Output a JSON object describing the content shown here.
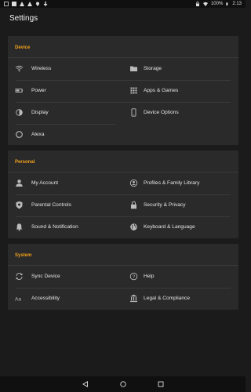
{
  "status_bar": {
    "time": "2:13",
    "battery": "100%"
  },
  "app_bar": {
    "title": "Settings"
  },
  "sections": [
    {
      "title": "Device",
      "items": [
        {
          "label": "Wireless",
          "icon": "wifi-icon"
        },
        {
          "label": "Storage",
          "icon": "folder-icon"
        },
        {
          "label": "Power",
          "icon": "battery-icon"
        },
        {
          "label": "Apps & Games",
          "icon": "apps-grid-icon"
        },
        {
          "label": "Display",
          "icon": "brightness-icon"
        },
        {
          "label": "Device Options",
          "icon": "phone-icon"
        },
        {
          "label": "Alexa",
          "icon": "alexa-ring-icon"
        }
      ]
    },
    {
      "title": "Personal",
      "items": [
        {
          "label": "My Account",
          "icon": "person-icon"
        },
        {
          "label": "Profiles & Family Library",
          "icon": "profiles-icon"
        },
        {
          "label": "Parental Controls",
          "icon": "shield-icon"
        },
        {
          "label": "Security & Privacy",
          "icon": "lock-icon"
        },
        {
          "label": "Sound & Notification",
          "icon": "bell-icon"
        },
        {
          "label": "Keyboard & Language",
          "icon": "globe-icon"
        }
      ]
    },
    {
      "title": "System",
      "items": [
        {
          "label": "Sync Device",
          "icon": "sync-icon"
        },
        {
          "label": "Help",
          "icon": "help-icon"
        },
        {
          "label": "Accessibility",
          "icon": "accessibility-text-icon"
        },
        {
          "label": "Legal & Compliance",
          "icon": "courthouse-icon"
        }
      ]
    }
  ],
  "nav_bar": {
    "back_icon": "back-triangle-icon",
    "home_icon": "home-circle-icon",
    "recents_icon": "recents-square-icon"
  },
  "colors": {
    "background": "#1b1b1b",
    "card": "#2a2a2a",
    "accent": "#f0a11c"
  }
}
